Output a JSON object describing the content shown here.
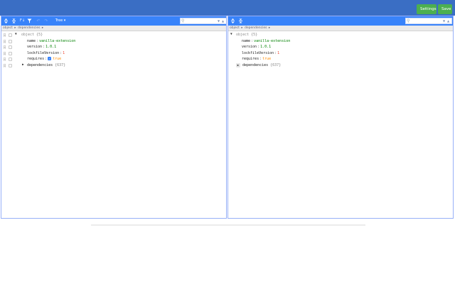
{
  "header": {
    "settings_label": "Settings",
    "save_label": "Save"
  },
  "left": {
    "menu": {
      "mode_label": "Tree ▾"
    },
    "nav": [
      "object",
      "▸",
      "dependencies",
      "▸"
    ],
    "tree": {
      "root": {
        "label": "object {5}"
      },
      "rows": [
        {
          "key": "name",
          "value": "vanilla-extension"
        },
        {
          "key": "version",
          "value": "1.0.1"
        },
        {
          "key": "lockfileVersion",
          "value": "1"
        },
        {
          "key": "requires",
          "value": "true"
        },
        {
          "key": "dependencies",
          "value": "{637}"
        }
      ]
    }
  },
  "right": {
    "nav": [
      "object",
      "▸",
      "dependencies",
      "▸"
    ],
    "tree": {
      "root": {
        "label": "object {5}"
      },
      "rows": [
        {
          "key": "name",
          "value": "vanilla-extension"
        },
        {
          "key": "version",
          "value": "1.0.1"
        },
        {
          "key": "lockfileVersion",
          "value": "1"
        },
        {
          "key": "requires",
          "value": "true"
        },
        {
          "key": "dependencies",
          "value": "{637}"
        }
      ]
    }
  },
  "colors": {
    "topbar": "#3a6ec4",
    "menu": "#3883fa",
    "button": "#4caf50"
  },
  "icons": [
    "expand-all-icon",
    "collapse-all-icon",
    "sort-icon",
    "filter-icon",
    "undo-icon",
    "redo-icon",
    "search-icon"
  ]
}
